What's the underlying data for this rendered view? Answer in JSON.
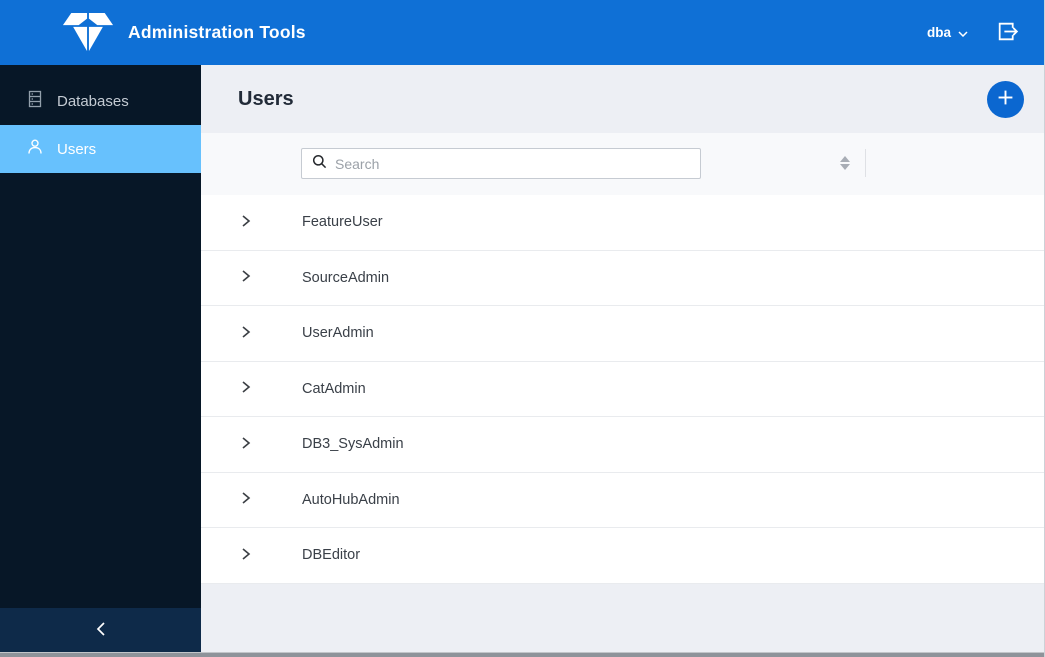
{
  "header": {
    "title": "Administration Tools",
    "user_menu_label": "dba"
  },
  "sidebar": {
    "items": [
      {
        "label": "Databases",
        "icon": "databases-icon",
        "selected": false
      },
      {
        "label": "Users",
        "icon": "users-icon",
        "selected": true
      }
    ]
  },
  "main": {
    "page_title": "Users",
    "search_placeholder": "Search",
    "users": [
      "FeatureUser",
      "SourceAdmin",
      "UserAdmin",
      "CatAdmin",
      "DB3_SysAdmin",
      "AutoHubAdmin",
      "DBEditor"
    ]
  },
  "icons": {
    "brand": "teradata-logo-icon",
    "header_right": [
      "chevron-down-icon",
      "logout-icon"
    ],
    "toolbar": [
      "search-icon",
      "sort-icon"
    ],
    "row": "chevron-right-icon",
    "sidebar_footer": "chevron-left-icon",
    "add": "plus-icon"
  },
  "colors": {
    "header_bar": "#0f70d6",
    "sidebar_bg": "#071727",
    "sidebar_selected": "#67c1fd",
    "add_button": "#0b67d0",
    "page_header_bg": "#edeff4",
    "toolbar_bg": "#f8f9fb",
    "row_bg": "#ffffff",
    "row_text": "#3a4048"
  }
}
